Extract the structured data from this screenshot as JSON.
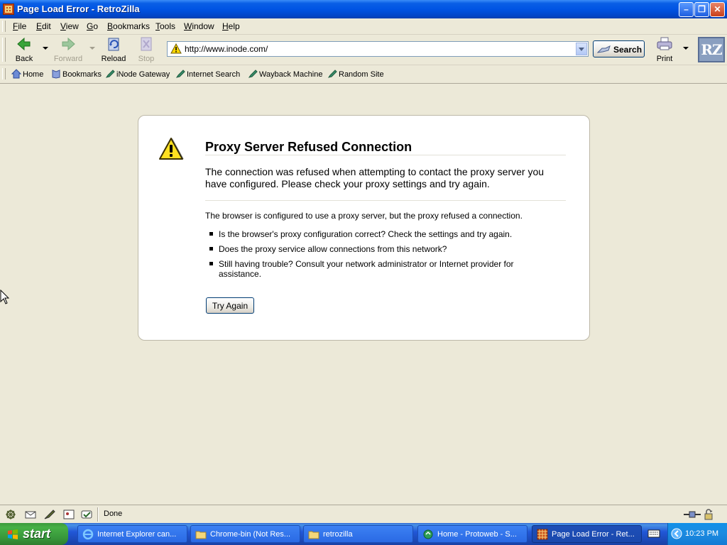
{
  "window": {
    "title": "Page Load Error - RetroZilla",
    "controls": [
      "minimize",
      "maximize",
      "close"
    ]
  },
  "menu": {
    "items": [
      {
        "label": "File",
        "accel": "F"
      },
      {
        "label": "Edit",
        "accel": "E"
      },
      {
        "label": "View",
        "accel": "V"
      },
      {
        "label": "Go",
        "accel": "G"
      },
      {
        "label": "Bookmarks",
        "accel": "B"
      },
      {
        "label": "Tools",
        "accel": "T"
      },
      {
        "label": "Window",
        "accel": "W"
      },
      {
        "label": "Help",
        "accel": "H"
      }
    ]
  },
  "toolbar": {
    "back_label": "Back",
    "forward_label": "Forward",
    "reload_label": "Reload",
    "stop_label": "Stop",
    "url": "http://www.inode.com/",
    "search_label": "Search",
    "print_label": "Print",
    "logo_text": "RZ"
  },
  "personal_toolbar": {
    "items": [
      {
        "label": "Home",
        "icon": "home-icon"
      },
      {
        "label": "Bookmarks",
        "icon": "bookmarks-icon"
      },
      {
        "label": "iNode Gateway",
        "icon": "bookmark-pen-icon"
      },
      {
        "label": "Internet Search",
        "icon": "bookmark-pen-icon"
      },
      {
        "label": "Wayback Machine",
        "icon": "bookmark-pen-icon"
      },
      {
        "label": "Random Site",
        "icon": "bookmark-pen-icon"
      }
    ]
  },
  "error_page": {
    "title": "Proxy Server Refused Connection",
    "short_desc": "The connection was refused when attempting to contact the proxy server you have configured. Please check your proxy settings and try again.",
    "long_desc": "The browser is configured to use a proxy server, but the proxy refused a connection.",
    "bullets": [
      "Is the browser's proxy configuration correct? Check the settings and try again.",
      "Does the proxy service allow connections from this network?",
      "Still having trouble? Consult your network administrator or Internet provider for assistance."
    ],
    "button_label": "Try Again"
  },
  "statusbar": {
    "text": "Done"
  },
  "taskbar": {
    "start_label": "start",
    "tasks": [
      {
        "label": "Internet Explorer can...",
        "icon": "ie-icon"
      },
      {
        "label": "Chrome-bin (Not Res...",
        "icon": "folder-icon"
      },
      {
        "label": "retrozilla",
        "icon": "folder-icon"
      },
      {
        "label": "Home - Protoweb - S...",
        "icon": "web-icon"
      },
      {
        "label": "Page Load Error - Ret...",
        "icon": "retrozilla-icon",
        "active": true
      }
    ],
    "clock": "10:23 PM"
  },
  "colors": {
    "titlebar_blue": "#0054e3",
    "chrome_beige": "#ece9d8",
    "start_green": "#3c9a3c",
    "warning_yellow": "#ffd800"
  }
}
